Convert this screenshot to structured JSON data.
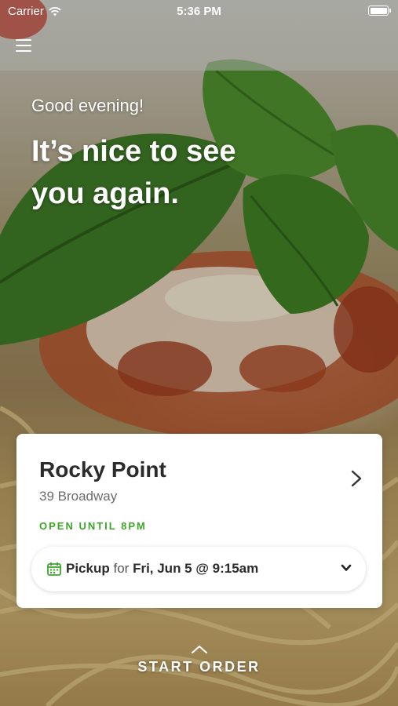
{
  "status_bar": {
    "carrier": "Carrier",
    "time": "5:36 PM"
  },
  "icons": {
    "menu": "menu-icon",
    "wifi": "wifi-icon",
    "battery": "battery-icon",
    "chevron_right": "chevron-right-icon",
    "calendar": "calendar-icon",
    "chevron_down": "chevron-down-icon",
    "chevron_up": "chevron-up-icon"
  },
  "hero": {
    "greeting": "Good evening!",
    "headline": "It’s nice to see you again."
  },
  "store": {
    "name": "Rocky Point",
    "address": "39 Broadway",
    "status": "OPEN UNTIL 8PM",
    "status_color": "#3da629"
  },
  "pickup": {
    "mode": "Pickup",
    "connector": "for",
    "when": "Fri, Jun 5 @ 9:15am"
  },
  "cta": {
    "label": "START ORDER"
  },
  "colors": {
    "accent_green": "#3da629",
    "card_bg": "#ffffff",
    "text_dark": "#2b2b2b"
  }
}
